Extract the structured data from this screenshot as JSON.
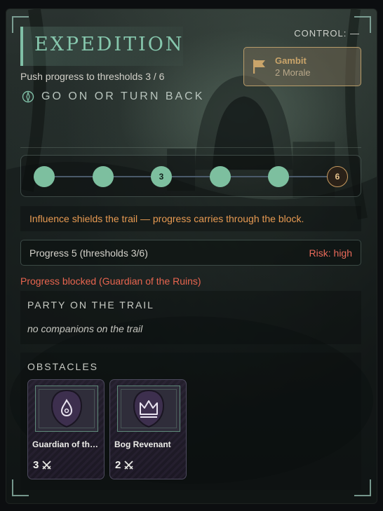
{
  "header": {
    "title": "EXPEDITION",
    "subtitle": "Push progress to thresholds 3 / 6",
    "choice_label": "GO ON OR TURN BACK",
    "control_label": "CONTROL: —"
  },
  "gambit": {
    "name": "Gambit",
    "cost": "2 Morale",
    "icon": "flag-icon"
  },
  "track": {
    "nodes": [
      {
        "label": "",
        "state": "filled"
      },
      {
        "label": "",
        "state": "filled"
      },
      {
        "label": "3",
        "state": "threshold"
      },
      {
        "label": "",
        "state": "filled"
      },
      {
        "label": "",
        "state": "filled"
      },
      {
        "label": "6",
        "state": "goal"
      }
    ]
  },
  "influence_text": "Influence shields the trail — progress carries through the block.",
  "progress": {
    "text": "Progress 5 (thresholds 3/6)",
    "risk": "Risk: high"
  },
  "blocked_text": "Progress blocked (Guardian of the Ruins)",
  "party": {
    "title": "PARTY ON THE TRAIL",
    "empty_text": "no companions on the trail"
  },
  "obstacles": {
    "title": "OBSTACLES",
    "cards": [
      {
        "name": "Guardian of the Ruins",
        "power": "3",
        "icon": "flame-icon"
      },
      {
        "name": "Bog Revenant",
        "power": "2",
        "icon": "crown-icon"
      }
    ]
  },
  "colors": {
    "accent": "#86c7ad",
    "node": "#7dbf9f",
    "goal": "#c79a5f",
    "warning": "#e79a52",
    "danger": "#ea6a5a"
  }
}
